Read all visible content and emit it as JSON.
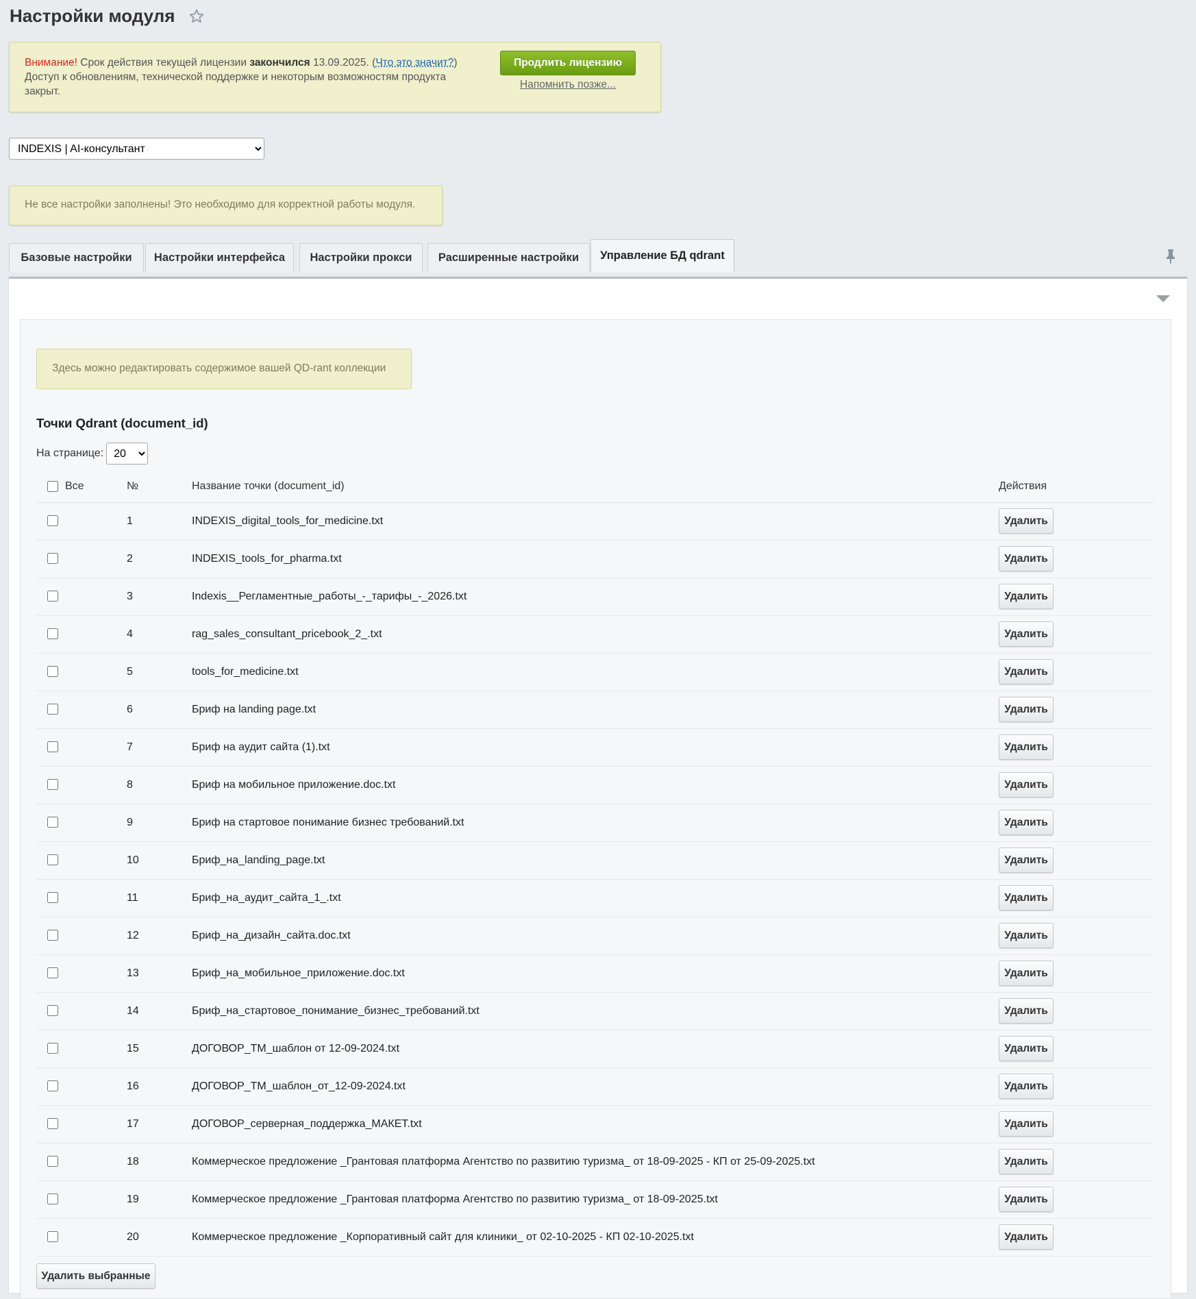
{
  "page": {
    "title": "Настройки модуля"
  },
  "license": {
    "warning_label": "Внимание!",
    "text_before": " Срок действия текущей лицензии ",
    "expired_word": "закончился",
    "date_text": " 13.09.2025. (",
    "what_link": "Что это значит?",
    "text_close": ")",
    "line2": "Доступ к обновлениям, технической поддержке и некоторым возможностям продукта закрыт.",
    "renew_button": "Продлить лицензию",
    "remind_link": "Напомнить позже..."
  },
  "module_select": {
    "selected": "INDEXIS | AI-консультант"
  },
  "notice": "Не все настройки заполнены! Это необходимо для корректной работы модуля.",
  "tabs": [
    {
      "label": "Базовые настройки"
    },
    {
      "label": "Настройки интерфейса"
    },
    {
      "label": "Настройки прокси"
    },
    {
      "label": "Расширенные настройки"
    },
    {
      "label": "Управление БД qdrant"
    }
  ],
  "panel": {
    "info": "Здесь можно редактировать содержимое вашей QD-rant коллекции",
    "section_title": "Точки Qdrant (document_id)",
    "per_page_label": "На странице:",
    "per_page_value": "20",
    "columns": {
      "all": "Все",
      "num": "№",
      "name": "Название точки (document_id)",
      "actions": "Действия"
    },
    "delete_label": "Удалить",
    "delete_selected": "Удалить выбранные",
    "rows": [
      {
        "num": "1",
        "name": "INDEXIS_digital_tools_for_medicine.txt"
      },
      {
        "num": "2",
        "name": "INDEXIS_tools_for_pharma.txt"
      },
      {
        "num": "3",
        "name": "Indexis__Регламентные_работы_-_тарифы_-_2026.txt"
      },
      {
        "num": "4",
        "name": "rag_sales_consultant_pricebook_2_.txt"
      },
      {
        "num": "5",
        "name": "tools_for_medicine.txt"
      },
      {
        "num": "6",
        "name": "Бриф на landing page.txt"
      },
      {
        "num": "7",
        "name": "Бриф на аудит сайта (1).txt"
      },
      {
        "num": "8",
        "name": "Бриф на мобильное приложение.doc.txt"
      },
      {
        "num": "9",
        "name": "Бриф на стартовое понимание бизнес требований.txt"
      },
      {
        "num": "10",
        "name": "Бриф_на_landing_page.txt"
      },
      {
        "num": "11",
        "name": "Бриф_на_аудит_сайта_1_.txt"
      },
      {
        "num": "12",
        "name": "Бриф_на_дизайн_сайта.doc.txt"
      },
      {
        "num": "13",
        "name": "Бриф_на_мобильное_приложение.doc.txt"
      },
      {
        "num": "14",
        "name": "Бриф_на_стартовое_понимание_бизнес_требований.txt"
      },
      {
        "num": "15",
        "name": "ДОГОВОР_ТМ_шаблон от 12-09-2024.txt"
      },
      {
        "num": "16",
        "name": "ДОГОВОР_ТМ_шаблон_от_12-09-2024.txt"
      },
      {
        "num": "17",
        "name": "ДОГОВОР_серверная_поддержка_МАКЕТ.txt"
      },
      {
        "num": "18",
        "name": "Коммерческое предложение _Грантовая платформа Агентство по развитию туризма_ от 18-09-2025 - КП от 25-09-2025.txt"
      },
      {
        "num": "19",
        "name": "Коммерческое предложение _Грантовая платформа Агентство по развитию туризма_ от 18-09-2025.txt"
      },
      {
        "num": "20",
        "name": "Коммерческое предложение _Корпоративный сайт для клиники_ от 02-10-2025 - КП 02-10-2025.txt"
      }
    ]
  },
  "colors": {
    "accent_green": "#7aac1c",
    "warning_red": "#d7281b",
    "notice_bg": "#f0f0cd"
  }
}
